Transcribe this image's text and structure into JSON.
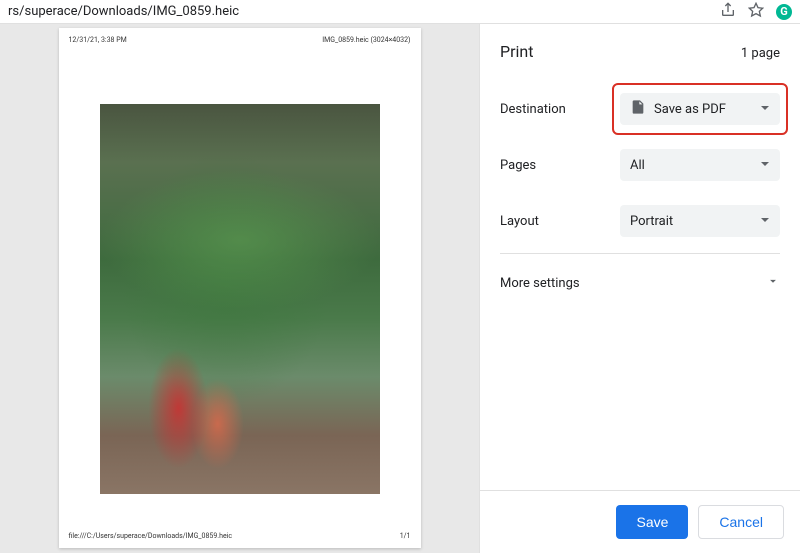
{
  "topbar": {
    "url_fragment": "rs/superace/Downloads/IMG_0859.heic"
  },
  "preview": {
    "timestamp": "12/31/21, 3:38 PM",
    "filename_dims": "IMG_0859.heic (3024×4032)",
    "file_uri": "file:///C:/Users/superace/Downloads/IMG_0859.heic",
    "page_indicator": "1/1"
  },
  "panel": {
    "title": "Print",
    "page_count": "1 page",
    "destination": {
      "label": "Destination",
      "value": "Save as PDF"
    },
    "pages": {
      "label": "Pages",
      "value": "All"
    },
    "layout": {
      "label": "Layout",
      "value": "Portrait"
    },
    "more": "More settings",
    "save": "Save",
    "cancel": "Cancel"
  }
}
